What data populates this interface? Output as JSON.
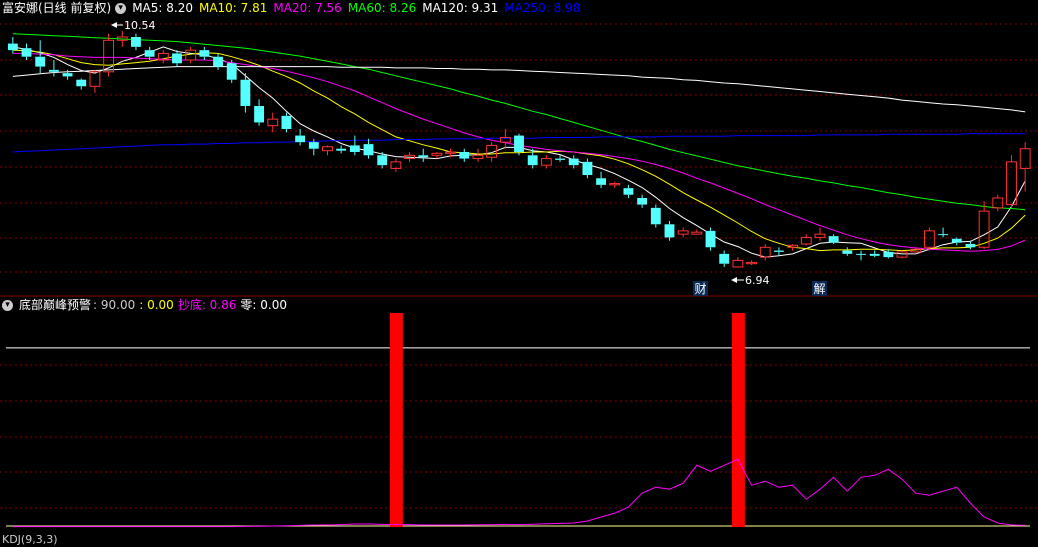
{
  "panel1": {
    "title": "富安娜(日线 前复权)",
    "ma_labels": [
      {
        "text": "MA5: 8.20",
        "color": "#ffffff"
      },
      {
        "text": "MA10: 7.81",
        "color": "#ffff00"
      },
      {
        "text": "MA20: 7.56",
        "color": "#ff00ff"
      },
      {
        "text": "MA60: 8.26",
        "color": "#00ff00"
      },
      {
        "text": "MA120: 9.31",
        "color": "#ffffff"
      },
      {
        "text": "MA250: 8.98",
        "color": "#0000ff"
      }
    ],
    "high_label": "10.54",
    "low_label": "6.94",
    "marker_cai": "财",
    "marker_jie": "解"
  },
  "panel2": {
    "title": "底部巅峰预警",
    "values": [
      {
        "text": ": 90.00",
        "color": "#cccccc"
      },
      {
        "text": ": 0.00",
        "color": "#ffff00"
      },
      {
        "text": "抄底: 0.86",
        "color": "#ff00ff"
      },
      {
        "text": "零: 0.00",
        "color": "#ffffff"
      }
    ]
  },
  "bottom_label": "KDJ(9,3,3)",
  "chart_data": [
    {
      "type": "candlestick",
      "title": "富安娜(日线 前复权)",
      "ylim": [
        6.6,
        10.8
      ],
      "candles": [
        [
          10.35,
          10.45,
          10.2,
          10.25
        ],
        [
          10.28,
          10.35,
          10.1,
          10.15
        ],
        [
          10.15,
          10.4,
          9.9,
          10.0
        ],
        [
          9.95,
          10.1,
          9.85,
          9.92
        ],
        [
          9.9,
          9.95,
          9.8,
          9.85
        ],
        [
          9.8,
          9.82,
          9.65,
          9.7
        ],
        [
          9.7,
          9.95,
          9.6,
          9.92
        ],
        [
          9.92,
          10.5,
          9.85,
          10.4
        ],
        [
          10.4,
          10.54,
          10.3,
          10.45
        ],
        [
          10.45,
          10.5,
          10.25,
          10.3
        ],
        [
          10.25,
          10.3,
          10.1,
          10.15
        ],
        [
          10.1,
          10.25,
          10.05,
          10.2
        ],
        [
          10.2,
          10.25,
          10.0,
          10.05
        ],
        [
          10.1,
          10.3,
          10.05,
          10.25
        ],
        [
          10.25,
          10.3,
          10.1,
          10.15
        ],
        [
          10.15,
          10.2,
          9.95,
          10.0
        ],
        [
          10.05,
          10.1,
          9.75,
          9.8
        ],
        [
          9.8,
          9.9,
          9.3,
          9.4
        ],
        [
          9.4,
          9.5,
          9.1,
          9.15
        ],
        [
          9.1,
          9.3,
          9.0,
          9.2
        ],
        [
          9.25,
          9.3,
          9.0,
          9.05
        ],
        [
          8.95,
          9.05,
          8.8,
          8.85
        ],
        [
          8.85,
          8.9,
          8.65,
          8.75
        ],
        [
          8.72,
          8.8,
          8.65,
          8.78
        ],
        [
          8.75,
          8.8,
          8.68,
          8.72
        ],
        [
          8.8,
          8.95,
          8.65,
          8.7
        ],
        [
          8.82,
          8.9,
          8.6,
          8.65
        ],
        [
          8.65,
          8.7,
          8.45,
          8.5
        ],
        [
          8.45,
          8.6,
          8.4,
          8.55
        ],
        [
          8.6,
          8.7,
          8.55,
          8.65
        ],
        [
          8.65,
          8.75,
          8.55,
          8.62
        ],
        [
          8.65,
          8.7,
          8.6,
          8.68
        ],
        [
          8.68,
          8.75,
          8.62,
          8.7
        ],
        [
          8.7,
          8.75,
          8.55,
          8.6
        ],
        [
          8.6,
          8.75,
          8.55,
          8.65
        ],
        [
          8.62,
          8.85,
          8.55,
          8.8
        ],
        [
          8.85,
          9.05,
          8.75,
          8.92
        ],
        [
          8.95,
          8.98,
          8.65,
          8.7
        ],
        [
          8.65,
          8.75,
          8.45,
          8.5
        ],
        [
          8.5,
          8.65,
          8.45,
          8.6
        ],
        [
          8.6,
          8.65,
          8.55,
          8.58
        ],
        [
          8.6,
          8.65,
          8.45,
          8.5
        ],
        [
          8.55,
          8.6,
          8.3,
          8.35
        ],
        [
          8.3,
          8.4,
          8.15,
          8.2
        ],
        [
          8.2,
          8.25,
          8.15,
          8.22
        ],
        [
          8.15,
          8.2,
          8.0,
          8.05
        ],
        [
          8.0,
          8.05,
          7.85,
          7.9
        ],
        [
          7.85,
          7.9,
          7.55,
          7.6
        ],
        [
          7.6,
          7.65,
          7.35,
          7.4
        ],
        [
          7.45,
          7.55,
          7.4,
          7.5
        ],
        [
          7.45,
          7.52,
          7.45,
          7.48
        ],
        [
          7.5,
          7.55,
          7.2,
          7.25
        ],
        [
          7.15,
          7.2,
          6.95,
          7.0
        ],
        [
          6.95,
          7.1,
          6.94,
          7.05
        ],
        [
          7.0,
          7.05,
          6.98,
          7.02
        ],
        [
          7.1,
          7.3,
          7.05,
          7.25
        ],
        [
          7.2,
          7.25,
          7.12,
          7.18
        ],
        [
          7.25,
          7.3,
          7.2,
          7.28
        ],
        [
          7.3,
          7.45,
          7.28,
          7.4
        ],
        [
          7.4,
          7.55,
          7.35,
          7.45
        ],
        [
          7.42,
          7.45,
          7.3,
          7.32
        ],
        [
          7.2,
          7.25,
          7.12,
          7.15
        ],
        [
          7.15,
          7.2,
          7.05,
          7.15
        ],
        [
          7.15,
          7.2,
          7.1,
          7.12
        ],
        [
          7.18,
          7.22,
          7.08,
          7.1
        ],
        [
          7.1,
          7.2,
          7.08,
          7.18
        ],
        [
          7.18,
          7.25,
          7.15,
          7.22
        ],
        [
          7.25,
          7.55,
          7.2,
          7.5
        ],
        [
          7.45,
          7.55,
          7.4,
          7.45
        ],
        [
          7.38,
          7.4,
          7.28,
          7.32
        ],
        [
          7.3,
          7.35,
          7.22,
          7.25
        ],
        [
          7.25,
          7.95,
          7.22,
          7.8
        ],
        [
          7.85,
          8.05,
          7.8,
          8.0
        ],
        [
          7.9,
          8.65,
          7.85,
          8.55
        ],
        [
          8.45,
          8.85,
          8.1,
          8.75
        ]
      ],
      "ma_series": [
        {
          "name": "MA5",
          "color": "#ffffff",
          "values": [
            10.3,
            10.26,
            10.21,
            10.14,
            10.03,
            9.94,
            9.9,
            9.98,
            10.08,
            10.14,
            10.22,
            10.3,
            10.23,
            10.2,
            10.18,
            10.12,
            10.04,
            9.86,
            9.68,
            9.52,
            9.32,
            9.13,
            9.02,
            8.93,
            8.83,
            8.76,
            8.72,
            8.67,
            8.63,
            8.62,
            8.61,
            8.6,
            8.64,
            8.65,
            8.66,
            8.69,
            8.77,
            8.77,
            8.72,
            8.7,
            8.66,
            8.58,
            8.51,
            8.45,
            8.37,
            8.27,
            8.16,
            8.01,
            7.84,
            7.7,
            7.58,
            7.45,
            7.33,
            7.26,
            7.16,
            7.1,
            7.12,
            7.15,
            7.23,
            7.31,
            7.33,
            7.32,
            7.31,
            7.24,
            7.17,
            7.15,
            7.15,
            7.22,
            7.29,
            7.33,
            7.34,
            7.44,
            7.56,
            7.87,
            8.26
          ]
        },
        {
          "name": "MA10",
          "color": "#ffff00",
          "values": [
            10.25,
            10.24,
            10.22,
            10.18,
            10.12,
            10.06,
            10.03,
            10.02,
            10.04,
            10.06,
            10.08,
            10.12,
            10.16,
            10.19,
            10.21,
            10.2,
            10.15,
            10.09,
            10.02,
            9.93,
            9.85,
            9.75,
            9.63,
            9.52,
            9.39,
            9.28,
            9.15,
            9.04,
            8.93,
            8.87,
            8.81,
            8.76,
            8.7,
            8.69,
            8.67,
            8.67,
            8.69,
            8.69,
            8.7,
            8.7,
            8.71,
            8.7,
            8.67,
            8.64,
            8.59,
            8.52,
            8.43,
            8.33,
            8.21,
            8.08,
            7.97,
            7.86,
            7.74,
            7.62,
            7.49,
            7.38,
            7.31,
            7.25,
            7.23,
            7.2,
            7.21,
            7.21,
            7.22,
            7.22,
            7.21,
            7.2,
            7.21,
            7.23,
            7.24,
            7.24,
            7.25,
            7.31,
            7.39,
            7.54,
            7.74
          ]
        },
        {
          "name": "MA20",
          "color": "#ff00ff",
          "values": [
            10.2,
            10.2,
            10.19,
            10.18,
            10.16,
            10.15,
            10.14,
            10.14,
            10.14,
            10.13,
            10.12,
            10.11,
            10.1,
            10.1,
            10.1,
            10.09,
            10.06,
            10.03,
            10.0,
            9.97,
            9.93,
            9.88,
            9.83,
            9.77,
            9.7,
            9.63,
            9.54,
            9.45,
            9.36,
            9.28,
            9.2,
            9.13,
            9.06,
            8.99,
            8.93,
            8.88,
            8.84,
            8.8,
            8.77,
            8.74,
            8.72,
            8.7,
            8.68,
            8.66,
            8.63,
            8.6,
            8.56,
            8.51,
            8.45,
            8.38,
            8.3,
            8.23,
            8.15,
            8.07,
            7.99,
            7.9,
            7.82,
            7.74,
            7.66,
            7.58,
            7.51,
            7.44,
            7.38,
            7.33,
            7.29,
            7.26,
            7.24,
            7.22,
            7.21,
            7.2,
            7.19,
            7.2,
            7.22,
            7.27,
            7.36
          ]
        },
        {
          "name": "MA60",
          "color": "#00ff00",
          "values": [
            10.5,
            10.49,
            10.48,
            10.47,
            10.46,
            10.45,
            10.44,
            10.43,
            10.42,
            10.41,
            10.4,
            10.39,
            10.38,
            10.36,
            10.34,
            10.32,
            10.3,
            10.28,
            10.25,
            10.22,
            10.19,
            10.16,
            10.12,
            10.08,
            10.04,
            10.0,
            9.96,
            9.91,
            9.86,
            9.81,
            9.76,
            9.71,
            9.66,
            9.6,
            9.55,
            9.49,
            9.44,
            9.38,
            9.32,
            9.27,
            9.21,
            9.15,
            9.09,
            9.03,
            8.97,
            8.91,
            8.86,
            8.8,
            8.74,
            8.69,
            8.64,
            8.59,
            8.54,
            8.49,
            8.45,
            8.41,
            8.37,
            8.33,
            8.3,
            8.26,
            8.23,
            8.19,
            8.16,
            8.12,
            8.08,
            8.05,
            8.01,
            7.98,
            7.95,
            7.92,
            7.9,
            7.87,
            7.85,
            7.84,
            7.82
          ]
        },
        {
          "name": "MA120",
          "color": "#ffffff",
          "values": [
            9.85,
            9.87,
            9.89,
            9.91,
            9.92,
            9.93,
            9.94,
            9.95,
            9.96,
            9.97,
            9.98,
            9.99,
            10.0,
            10.0,
            10.0,
            10.0,
            10.0,
            10.0,
            10.0,
            10.0,
            10.0,
            10.0,
            10.0,
            10.0,
            9.99,
            9.99,
            9.99,
            9.99,
            9.98,
            9.98,
            9.98,
            9.97,
            9.97,
            9.96,
            9.96,
            9.95,
            9.95,
            9.94,
            9.93,
            9.92,
            9.91,
            9.9,
            9.89,
            9.88,
            9.87,
            9.86,
            9.84,
            9.83,
            9.82,
            9.8,
            9.79,
            9.77,
            9.75,
            9.74,
            9.72,
            9.7,
            9.68,
            9.66,
            9.64,
            9.62,
            9.6,
            9.58,
            9.56,
            9.54,
            9.52,
            9.49,
            9.47,
            9.45,
            9.43,
            9.42,
            9.4,
            9.38,
            9.36,
            9.34,
            9.31
          ]
        },
        {
          "name": "MA250",
          "color": "#0000ff",
          "values": [
            8.7,
            8.71,
            8.72,
            8.73,
            8.74,
            8.75,
            8.76,
            8.77,
            8.78,
            8.79,
            8.8,
            8.81,
            8.81,
            8.82,
            8.82,
            8.83,
            8.83,
            8.84,
            8.84,
            8.85,
            8.85,
            8.86,
            8.86,
            8.87,
            8.87,
            8.88,
            8.88,
            8.88,
            8.89,
            8.89,
            8.89,
            8.9,
            8.9,
            8.9,
            8.9,
            8.91,
            8.91,
            8.91,
            8.91,
            8.92,
            8.92,
            8.92,
            8.92,
            8.93,
            8.93,
            8.93,
            8.93,
            8.93,
            8.94,
            8.94,
            8.94,
            8.94,
            8.94,
            8.95,
            8.95,
            8.95,
            8.95,
            8.95,
            8.95,
            8.96,
            8.96,
            8.96,
            8.96,
            8.96,
            8.97,
            8.97,
            8.97,
            8.97,
            8.97,
            8.97,
            8.98,
            8.98,
            8.98,
            8.98,
            8.98
          ]
        }
      ]
    },
    {
      "type": "bar",
      "title": "底部巅峰预警",
      "ylim": [
        0,
        100
      ],
      "reference_line": 90,
      "signal_bars": [
        {
          "index": 28,
          "value": 100
        },
        {
          "index": 53,
          "value": 100
        }
      ],
      "series": [
        {
          "name": "抄底",
          "color": "#ff00ff",
          "values": [
            0.2,
            0.2,
            0.2,
            0.2,
            0.2,
            0.2,
            0.2,
            0.2,
            0.2,
            0.2,
            0.2,
            0.2,
            0.2,
            0.2,
            0.2,
            0.2,
            0.2,
            0.3,
            0.4,
            0.5,
            0.6,
            0.8,
            1.0,
            1.0,
            1.2,
            1.5,
            1.5,
            1.3,
            1.2,
            1.2,
            1.0,
            1.0,
            1.0,
            1.0,
            1.1,
            1.2,
            1.3,
            1.2,
            1.4,
            1.6,
            1.8,
            2.0,
            3.0,
            5.0,
            7.0,
            10.0,
            17.0,
            20.0,
            19.0,
            22.0,
            31.0,
            28.0,
            31.0,
            34.0,
            21.0,
            23.0,
            20.0,
            21.0,
            14.0,
            19.0,
            25.0,
            18.0,
            25.0,
            26.0,
            29.0,
            24.0,
            17.0,
            16.0,
            18.0,
            20.0,
            12.0,
            5.0,
            2.0,
            1.0,
            0.86
          ]
        }
      ]
    }
  ]
}
